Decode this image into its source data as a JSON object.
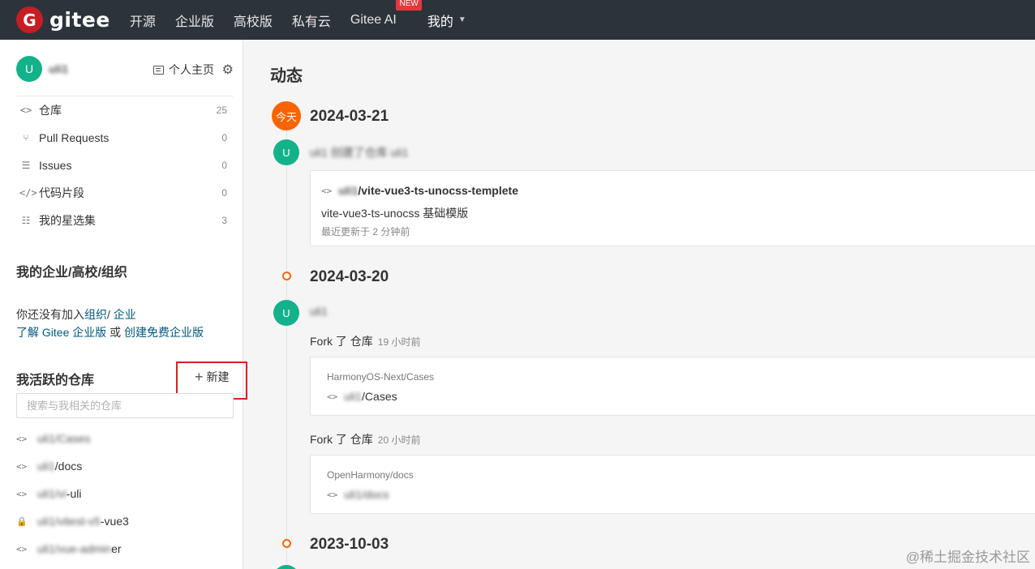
{
  "topbar": {
    "logo_letter": "G",
    "logo_text": "gitee",
    "nav": [
      "开源",
      "企业版",
      "高校版",
      "私有云",
      "Gitee AI"
    ],
    "new_badge": "NEW",
    "mine": "我的"
  },
  "sidebar": {
    "avatar_letter": "U",
    "username": "uli1",
    "home_link": "个人主页",
    "menu": [
      {
        "icon": "<>",
        "label": "仓库",
        "count": "25"
      },
      {
        "icon": "⑂",
        "label": "Pull Requests",
        "count": "0"
      },
      {
        "icon": "☰",
        "label": "Issues",
        "count": "0"
      },
      {
        "icon": "</>",
        "label": "代码片段",
        "count": "0"
      },
      {
        "icon": "☷",
        "label": "我的星选集",
        "count": "3"
      }
    ],
    "org_title": "我的企业/高校/组织",
    "org_line1_prefix": "你还没有加入",
    "org_link1": "组织",
    "org_sep": "/ ",
    "org_link2": "企业",
    "org_line2_link1": "了解 Gitee 企业版",
    "org_line2_mid": " 或 ",
    "org_line2_link2": "创建免费企业版",
    "active_repos_title": "我活跃的仓库",
    "new_label": "新建",
    "search_placeholder": "搜索与我相关的仓库",
    "repos": [
      {
        "icon": "<>",
        "blurred": "uli1/Cases",
        "visible": ""
      },
      {
        "icon": "<>",
        "blurred": "uli1",
        "visible": "/docs"
      },
      {
        "icon": "<>",
        "blurred": "uli1/vi",
        "visible": "-uli"
      },
      {
        "icon": "🔒",
        "blurred": "uli1/vitest-v5",
        "visible": "-vue3"
      },
      {
        "icon": "<>",
        "blurred": "uli1/vue-admin",
        "visible": "er"
      }
    ]
  },
  "feed": {
    "title": "动态",
    "today": "今天",
    "groups": [
      {
        "date": "2024-03-21",
        "avatar": "U",
        "user_blur": "uli1 创建了仓库 uli1",
        "card": {
          "repo_owner": "uli1",
          "repo_name": "/vite-vue3-ts-unocss-templete",
          "desc": "vite-vue3-ts-unocss 基础模版",
          "updated": "最近更新于 2 分钟前"
        }
      },
      {
        "date": "2024-03-20",
        "avatar": "U",
        "user_blur": "uli1",
        "forks": [
          {
            "text": "Fork 了 仓库",
            "time": "19 小时前",
            "source": "HarmonyOS-Next/Cases",
            "owner": "uli1",
            "name": "/Cases"
          },
          {
            "text": "Fork 了 仓库",
            "time": "20 小时前",
            "source": "OpenHarmony/docs",
            "owner": "uli1/docs",
            "name": ""
          }
        ]
      },
      {
        "date": "2023-10-03"
      }
    ]
  },
  "watermark": "@稀土掘金技术社区",
  "colors": {
    "brand": "#c71d23",
    "accent": "#fa6400",
    "avatar": "#14b28a",
    "link": "#005980"
  }
}
